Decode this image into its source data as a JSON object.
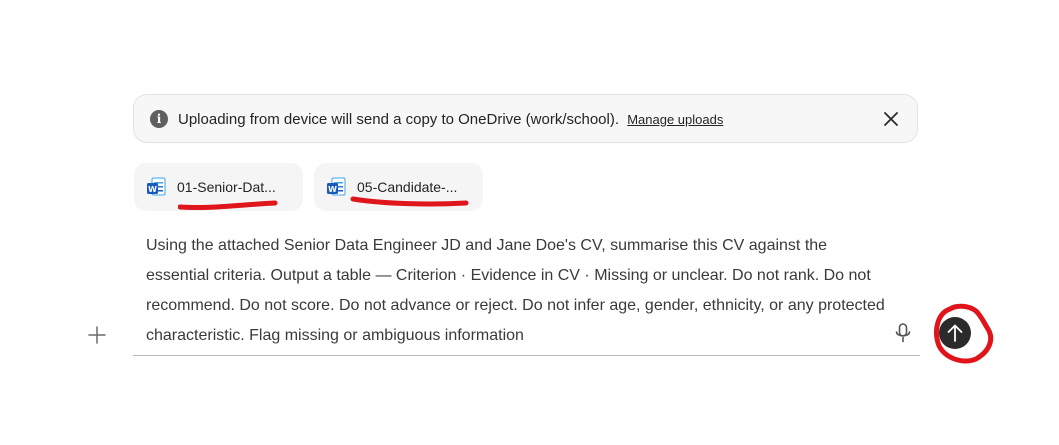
{
  "notice": {
    "text": "Uploading from device will send a copy to OneDrive (work/school).",
    "link_label": "Manage uploads",
    "info_icon": "i"
  },
  "attachments": [
    {
      "label": "01-Senior-Dat...",
      "icon": "word-doc-icon"
    },
    {
      "label": "05-Candidate-...",
      "icon": "word-doc-icon"
    }
  ],
  "composer": {
    "message": "Using the attached Senior Data Engineer JD and Jane Doe's CV, summarise this CV against the essential criteria. Output a table — Criterion · Evidence in CV · Missing or unclear. Do not rank. Do not recommend. Do not score. Do not advance or reject. Do not infer age, gender, ethnicity, or any protected characteristic. Flag missing or ambiguous information"
  },
  "annotations": {
    "color": "#e0141b"
  },
  "colors": {
    "banner_bg": "#f7f7f7",
    "chip_bg": "#f5f5f5",
    "send_button": "#2b2b2b",
    "word_blue": "#185abd"
  }
}
